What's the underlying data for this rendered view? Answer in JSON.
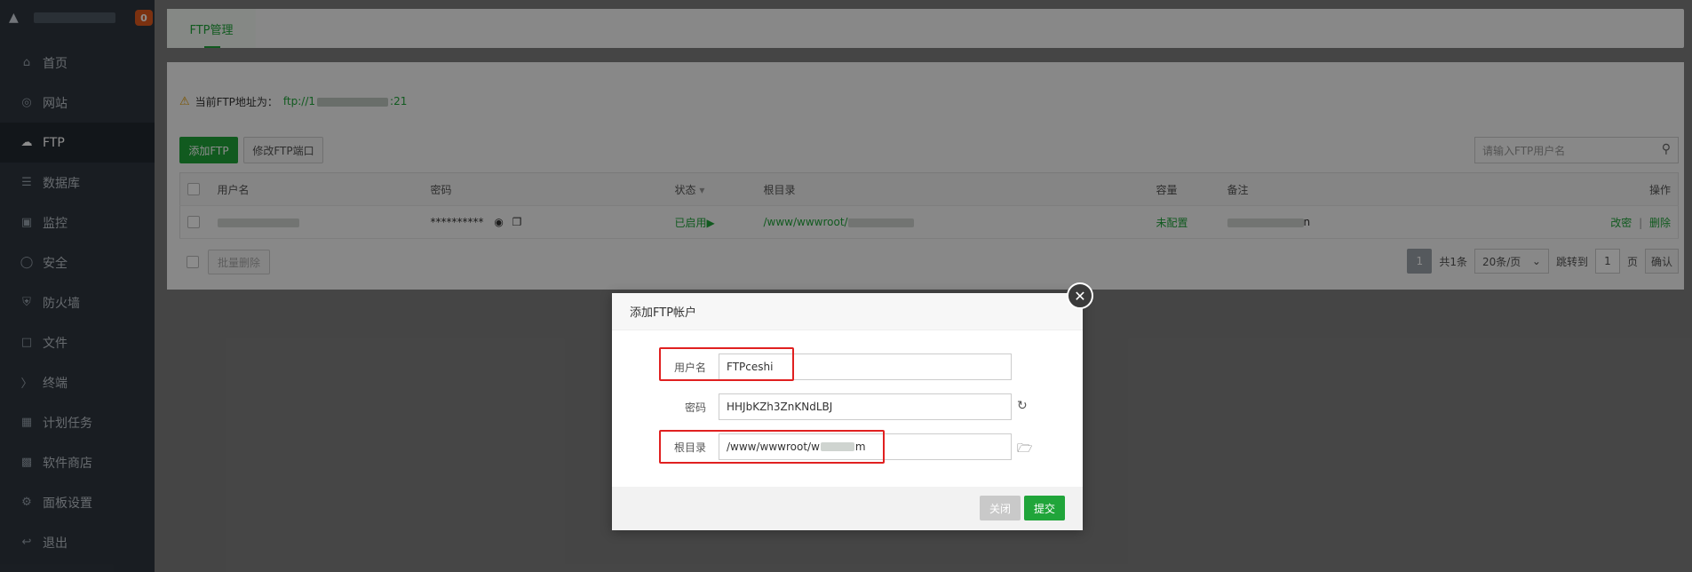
{
  "sidebar": {
    "badge": "0",
    "items": [
      {
        "label": "首页",
        "icon": "home-icon"
      },
      {
        "label": "网站",
        "icon": "globe-icon"
      },
      {
        "label": "FTP",
        "icon": "ftp-icon"
      },
      {
        "label": "数据库",
        "icon": "database-icon"
      },
      {
        "label": "监控",
        "icon": "monitor-icon"
      },
      {
        "label": "安全",
        "icon": "shield-icon"
      },
      {
        "label": "防火墙",
        "icon": "firewall-icon"
      },
      {
        "label": "文件",
        "icon": "folder-icon"
      },
      {
        "label": "终端",
        "icon": "terminal-icon"
      },
      {
        "label": "计划任务",
        "icon": "calendar-icon"
      },
      {
        "label": "软件商店",
        "icon": "apps-icon"
      },
      {
        "label": "面板设置",
        "icon": "gear-icon"
      },
      {
        "label": "退出",
        "icon": "logout-icon"
      }
    ]
  },
  "tabs": {
    "ftp_manage": "FTP管理"
  },
  "notice": {
    "prefix": "当前FTP地址为：",
    "addr_start": "ftp://1",
    "addr_end": ":21"
  },
  "toolbar": {
    "add_ftp": "添加FTP",
    "edit_port": "修改FTP端口",
    "search_placeholder": "请输入FTP用户名"
  },
  "table": {
    "headers": {
      "username": "用户名",
      "password": "密码",
      "status": "状态",
      "root": "根目录",
      "capacity": "容量",
      "remark": "备注",
      "actions": "操作"
    },
    "row": {
      "password": "**********",
      "status": "已启用",
      "root": "/www/wwwroot/",
      "capacity": "未配置",
      "remark_tail": "n",
      "edit": "改密",
      "sep": "|",
      "delete": "删除"
    }
  },
  "footer": {
    "batch_delete": "批量删除",
    "page": "1",
    "total": "共1条",
    "per_page": "20条/页",
    "jump_label": "跳转到",
    "jump_value": "1",
    "page_unit": "页",
    "confirm": "确认"
  },
  "modal": {
    "title": "添加FTP帐户",
    "username_label": "用户名",
    "username_value": "FTPceshi",
    "password_label": "密码",
    "password_value": "HHJbKZh3ZnKNdLBJ",
    "root_label": "根目录",
    "root_value_start": "/www/wwwroot/w",
    "root_value_end": "m",
    "close": "关闭",
    "submit": "提交"
  }
}
